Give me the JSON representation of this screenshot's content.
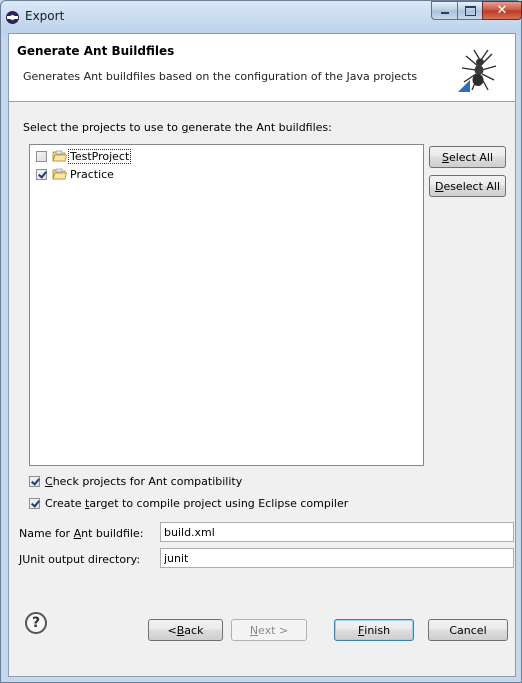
{
  "window": {
    "title": "Export"
  },
  "header": {
    "title": "Generate Ant Buildfiles",
    "description": "Generates Ant buildfiles based on the configuration of the Java projects"
  },
  "projects_label": {
    "pre": "Select the projects to use to ",
    "u": "g",
    "post": "enerate the Ant buildfiles:"
  },
  "projects": [
    {
      "name": "TestProject",
      "checked": false
    },
    {
      "name": "Practice",
      "checked": true
    }
  ],
  "side_buttons": {
    "select_all": {
      "u": "S",
      "rest": "elect All"
    },
    "deselect_all": {
      "u": "D",
      "rest": "eselect All"
    }
  },
  "options": {
    "check_compat": {
      "checked": true,
      "u": "C",
      "rest": "heck projects for Ant compatibility"
    },
    "create_target": {
      "checked": true,
      "pre": "Create ",
      "u": "t",
      "rest": "arget to compile project using Eclipse compiler"
    }
  },
  "fields": {
    "buildfile": {
      "pre": "Name for ",
      "u": "A",
      "rest": "nt buildfile:",
      "value": "build.xml"
    },
    "junit": {
      "u": "J",
      "rest": "Unit output directory:",
      "value": "junit"
    }
  },
  "footer": {
    "help": "?",
    "back": {
      "pre": "< ",
      "u": "B",
      "rest": "ack"
    },
    "next": {
      "u": "N",
      "rest": "ext >"
    },
    "finish": {
      "u": "F",
      "rest": "inish"
    },
    "cancel": "Cancel"
  }
}
